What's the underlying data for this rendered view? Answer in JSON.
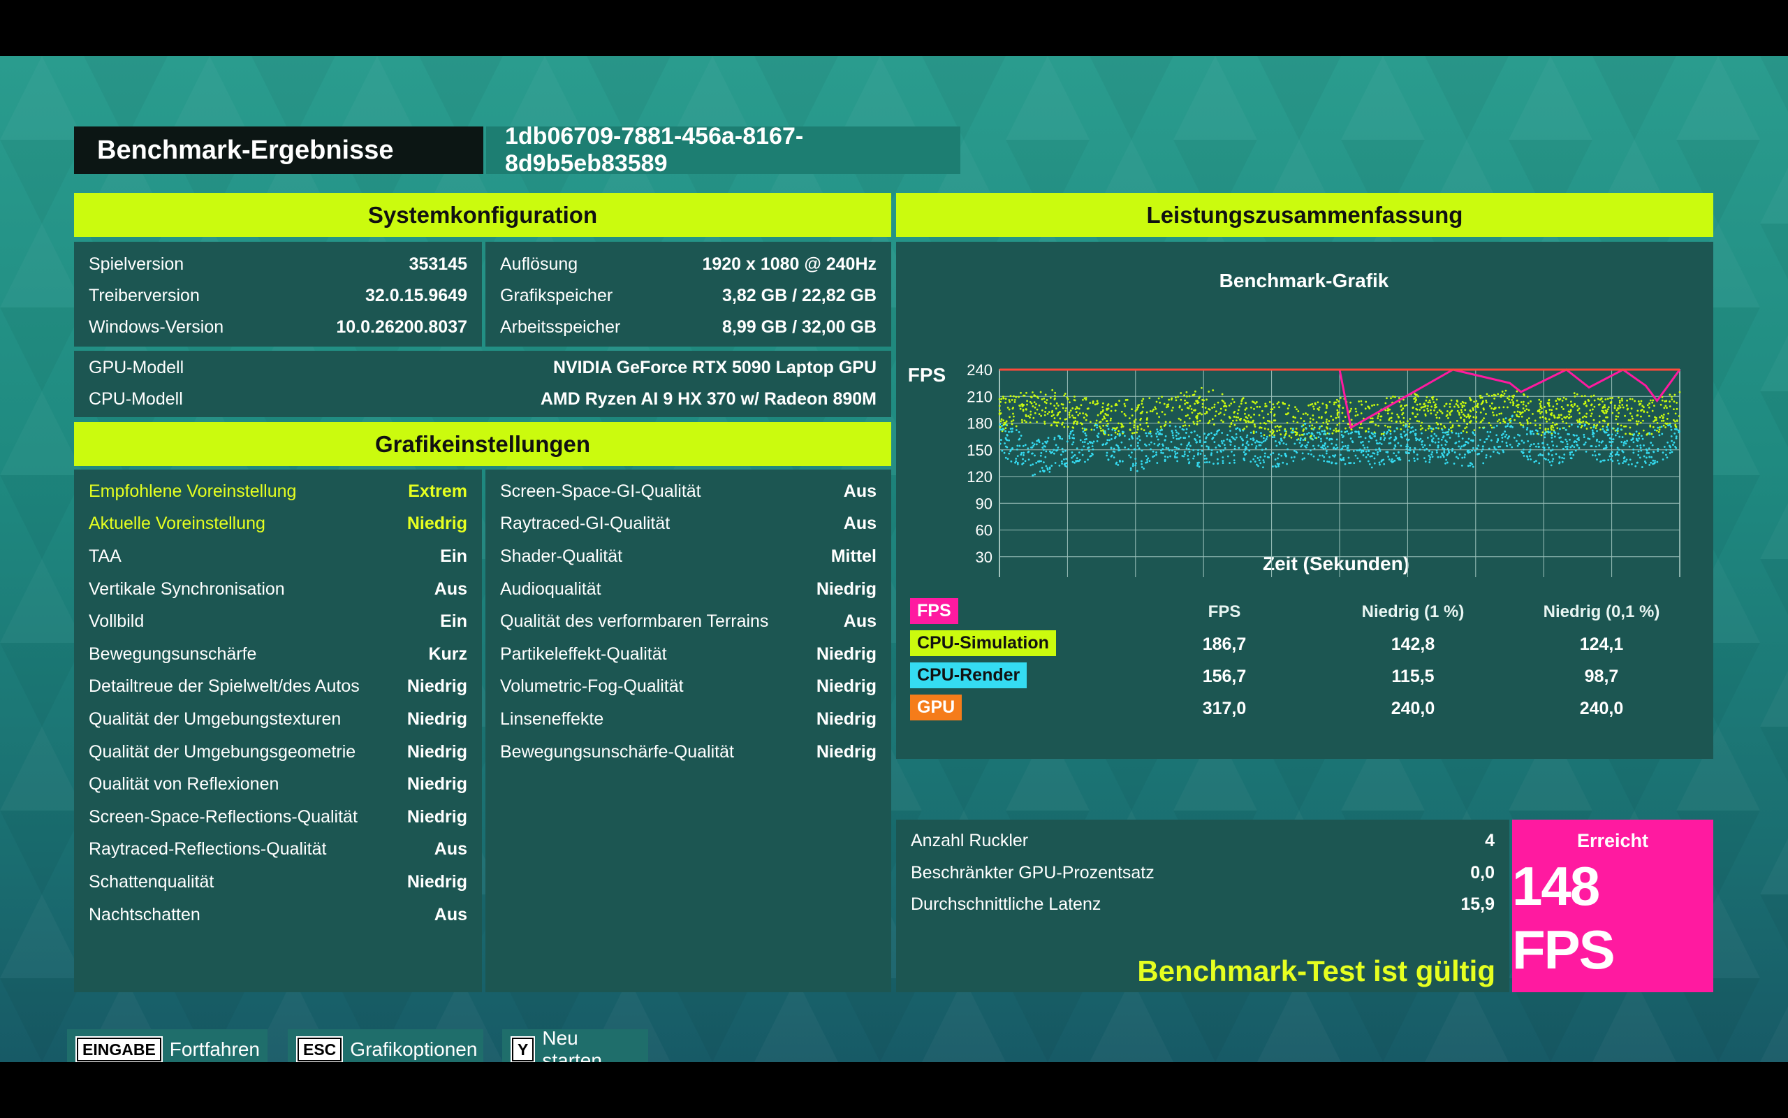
{
  "header": {
    "title": "Benchmark-Ergebnisse",
    "run_id": "1db06709-7881-456a-8167-8d9b5eb83589"
  },
  "system": {
    "heading": "Systemkonfiguration",
    "left": [
      {
        "label": "Spielversion",
        "value": "353145"
      },
      {
        "label": "Treiberversion",
        "value": "32.0.15.9649"
      },
      {
        "label": "Windows-Version",
        "value": "10.0.26200.8037"
      }
    ],
    "right": [
      {
        "label": "Auflösung",
        "value": "1920 x 1080 @ 240Hz"
      },
      {
        "label": "Grafikspeicher",
        "value": "3,82 GB / 22,82 GB"
      },
      {
        "label": "Arbeitsspeicher",
        "value": "8,99 GB / 32,00 GB"
      }
    ],
    "hardware": [
      {
        "label": "GPU-Modell",
        "value": "NVIDIA GeForce RTX 5090 Laptop GPU"
      },
      {
        "label": "CPU-Modell",
        "value": "AMD Ryzen AI 9 HX 370 w/ Radeon 890M"
      }
    ]
  },
  "graphics": {
    "heading": "Grafikeinstellungen",
    "left": [
      {
        "label": "Empfohlene Voreinstellung",
        "value": "Extrem",
        "highlight": true
      },
      {
        "label": "Aktuelle Voreinstellung",
        "value": "Niedrig",
        "highlight": true
      },
      {
        "label": "TAA",
        "value": "Ein"
      },
      {
        "label": "Vertikale Synchronisation",
        "value": "Aus"
      },
      {
        "label": "Vollbild",
        "value": "Ein"
      },
      {
        "label": "Bewegungsunschärfe",
        "value": "Kurz"
      },
      {
        "label": "Detailtreue der Spielwelt/des Autos",
        "value": "Niedrig"
      },
      {
        "label": "Qualität der Umgebungstexturen",
        "value": "Niedrig"
      },
      {
        "label": "Qualität der Umgebungsgeometrie",
        "value": "Niedrig"
      },
      {
        "label": "Qualität von Reflexionen",
        "value": "Niedrig"
      },
      {
        "label": "Screen-Space-Reflections-Qualität",
        "value": "Niedrig"
      },
      {
        "label": "Raytraced-Reflections-Qualität",
        "value": "Aus"
      },
      {
        "label": "Schattenqualität",
        "value": "Niedrig"
      },
      {
        "label": "Nachtschatten",
        "value": "Aus"
      }
    ],
    "right": [
      {
        "label": "Screen-Space-GI-Qualität",
        "value": "Aus"
      },
      {
        "label": "Raytraced-GI-Qualität",
        "value": "Aus"
      },
      {
        "label": "Shader-Qualität",
        "value": "Mittel"
      },
      {
        "label": "Audioqualität",
        "value": "Niedrig"
      },
      {
        "label": "Qualität des verformbaren Terrains",
        "value": "Aus"
      },
      {
        "label": "Partikeleffekt-Qualität",
        "value": "Niedrig"
      },
      {
        "label": "Volumetric-Fog-Qualität",
        "value": "Niedrig"
      },
      {
        "label": "Linseneffekte",
        "value": "Niedrig"
      },
      {
        "label": "Bewegungsunschärfe-Qualität",
        "value": "Niedrig"
      }
    ]
  },
  "performance": {
    "heading": "Leistungszusammenfassung",
    "chart_title": "Benchmark-Grafik",
    "y_label": "FPS",
    "x_label": "Zeit (Sekunden)",
    "stats_headers": [
      "FPS",
      "Niedrig (1 %)",
      "Niedrig (0,1 %)"
    ],
    "legend": [
      {
        "label": "FPS",
        "color": "#ff1aa0"
      },
      {
        "label": "CPU-Simulation",
        "color": "#cbfb0e"
      },
      {
        "label": "CPU-Render",
        "color": "#35dcf2"
      },
      {
        "label": "GPU",
        "color": "#f57c1a"
      }
    ],
    "stats_rows": [
      {
        "name": "CPU-Simulation",
        "fps": "186,7",
        "low1": "142,8",
        "low01": "124,1"
      },
      {
        "name": "CPU-Render",
        "fps": "156,7",
        "low1": "115,5",
        "low01": "98,7"
      },
      {
        "name": "GPU",
        "fps": "317,0",
        "low1": "240,0",
        "low01": "240,0"
      }
    ],
    "summary": [
      {
        "label": "Anzahl Ruckler",
        "value": "4"
      },
      {
        "label": "Beschränkter GPU-Prozentsatz",
        "value": "0,0"
      },
      {
        "label": "Durchschnittliche Latenz",
        "value": "15,9"
      }
    ],
    "valid_text": "Benchmark-Test ist gültig",
    "achieved_label": "Erreicht",
    "achieved_value": "148 FPS"
  },
  "footer": {
    "buttons": [
      {
        "key": "EINGABE",
        "label": "Fortfahren"
      },
      {
        "key": "ESC",
        "label": "Grafikoptionen"
      },
      {
        "key": "Y",
        "label": "Neu starten"
      }
    ]
  },
  "chart_data": {
    "type": "scatter",
    "title": "Benchmark-Grafik",
    "xlabel": "Zeit (Sekunden)",
    "ylabel": "FPS",
    "xlim": [
      0,
      60
    ],
    "ylim": [
      0,
      240
    ],
    "xticks": [
      6,
      12,
      18,
      24,
      30,
      36,
      42,
      48,
      54,
      60
    ],
    "yticks": [
      0,
      30,
      60,
      90,
      120,
      150,
      180,
      210,
      240
    ],
    "grid": true,
    "series": [
      {
        "name": "CPU-Simulation",
        "color": "#cbfb0e",
        "x": [
          0,
          3,
          6,
          9,
          12,
          15,
          18,
          21,
          24,
          27,
          30,
          33,
          36,
          39,
          42,
          45,
          48,
          51,
          54,
          57,
          60
        ],
        "y": [
          190,
          200,
          195,
          185,
          188,
          192,
          200,
          190,
          185,
          180,
          190,
          185,
          195,
          188,
          190,
          200,
          185,
          195,
          190,
          185,
          195
        ]
      },
      {
        "name": "CPU-Render",
        "color": "#35dcf2",
        "x": [
          0,
          3,
          6,
          9,
          12,
          15,
          18,
          21,
          24,
          27,
          30,
          33,
          36,
          39,
          42,
          45,
          48,
          51,
          54,
          57,
          60
        ],
        "y": [
          165,
          140,
          150,
          160,
          145,
          158,
          150,
          155,
          148,
          160,
          152,
          150,
          158,
          155,
          150,
          170,
          150,
          160,
          155,
          150,
          165
        ]
      },
      {
        "name": "FPS",
        "color": "#ff1aa0",
        "x": [
          0,
          10,
          20,
          30,
          31,
          40,
          45,
          46,
          50,
          52,
          55,
          57,
          58,
          60
        ],
        "y": [
          240,
          240,
          240,
          240,
          175,
          240,
          225,
          215,
          240,
          220,
          240,
          222,
          205,
          240
        ]
      },
      {
        "name": "GPU",
        "color": "#ff4a3a",
        "x": [
          0,
          60
        ],
        "y": [
          240,
          240
        ]
      }
    ]
  }
}
